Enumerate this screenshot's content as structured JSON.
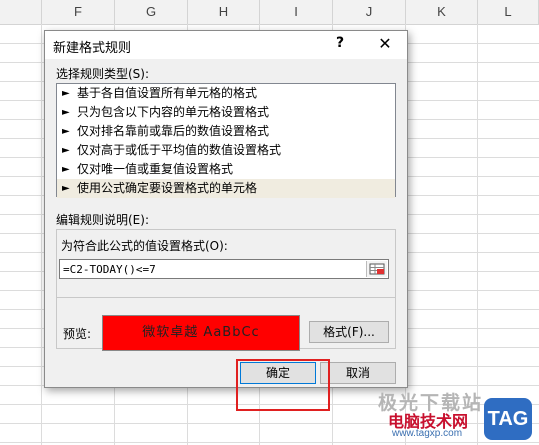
{
  "sheet": {
    "columns": [
      "F",
      "G",
      "H",
      "I",
      "J",
      "K",
      "L"
    ]
  },
  "dialog": {
    "title": "新建格式规则",
    "help": "?",
    "close": "✕",
    "rule_type_label": "选择规则类型(S):",
    "rule_types": [
      "基于各自值设置所有单元格的格式",
      "只为包含以下内容的单元格设置格式",
      "仅对排名靠前或靠后的数值设置格式",
      "仅对高于或低于平均值的数值设置格式",
      "仅对唯一值或重复值设置格式",
      "使用公式确定要设置格式的单元格"
    ],
    "rule_arrow": "►",
    "edit_label": "编辑规则说明(E):",
    "formula_label": "为符合此公式的值设置格式(O):",
    "formula_value": "=C2-TODAY()<=7",
    "preview_label": "预览:",
    "preview_text": "微软卓越  AaBbCc",
    "preview_color": "#ff0000",
    "format_button": "格式(F)...",
    "ok_button": "确定",
    "cancel_button": "取消"
  },
  "watermark": {
    "line1": "极光下载站",
    "line2": "电脑技术网",
    "line3": "www.tagxp.com",
    "logo": "TAG"
  }
}
